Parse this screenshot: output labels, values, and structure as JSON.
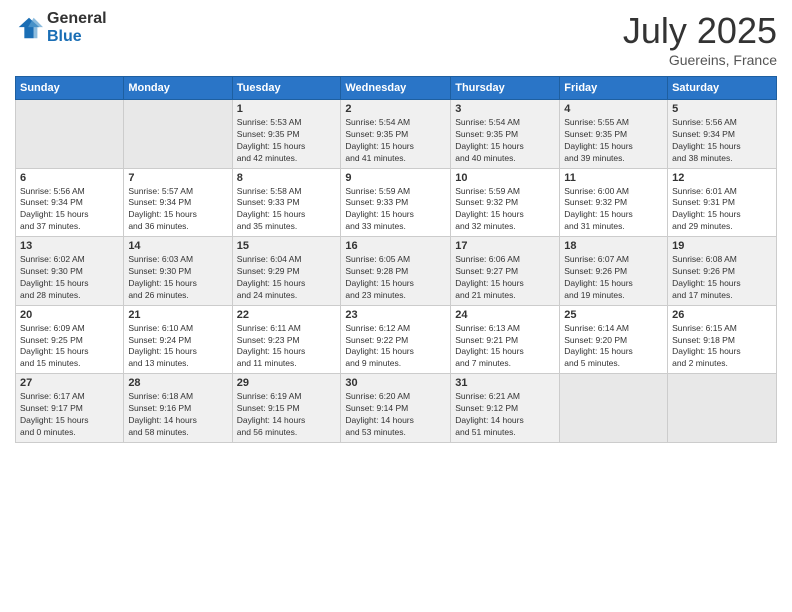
{
  "header": {
    "logo_general": "General",
    "logo_blue": "Blue",
    "month_title": "July 2025",
    "location": "Guereins, France"
  },
  "weekdays": [
    "Sunday",
    "Monday",
    "Tuesday",
    "Wednesday",
    "Thursday",
    "Friday",
    "Saturday"
  ],
  "weeks": [
    [
      {
        "day": "",
        "info": ""
      },
      {
        "day": "",
        "info": ""
      },
      {
        "day": "1",
        "info": "Sunrise: 5:53 AM\nSunset: 9:35 PM\nDaylight: 15 hours\nand 42 minutes."
      },
      {
        "day": "2",
        "info": "Sunrise: 5:54 AM\nSunset: 9:35 PM\nDaylight: 15 hours\nand 41 minutes."
      },
      {
        "day": "3",
        "info": "Sunrise: 5:54 AM\nSunset: 9:35 PM\nDaylight: 15 hours\nand 40 minutes."
      },
      {
        "day": "4",
        "info": "Sunrise: 5:55 AM\nSunset: 9:35 PM\nDaylight: 15 hours\nand 39 minutes."
      },
      {
        "day": "5",
        "info": "Sunrise: 5:56 AM\nSunset: 9:34 PM\nDaylight: 15 hours\nand 38 minutes."
      }
    ],
    [
      {
        "day": "6",
        "info": "Sunrise: 5:56 AM\nSunset: 9:34 PM\nDaylight: 15 hours\nand 37 minutes."
      },
      {
        "day": "7",
        "info": "Sunrise: 5:57 AM\nSunset: 9:34 PM\nDaylight: 15 hours\nand 36 minutes."
      },
      {
        "day": "8",
        "info": "Sunrise: 5:58 AM\nSunset: 9:33 PM\nDaylight: 15 hours\nand 35 minutes."
      },
      {
        "day": "9",
        "info": "Sunrise: 5:59 AM\nSunset: 9:33 PM\nDaylight: 15 hours\nand 33 minutes."
      },
      {
        "day": "10",
        "info": "Sunrise: 5:59 AM\nSunset: 9:32 PM\nDaylight: 15 hours\nand 32 minutes."
      },
      {
        "day": "11",
        "info": "Sunrise: 6:00 AM\nSunset: 9:32 PM\nDaylight: 15 hours\nand 31 minutes."
      },
      {
        "day": "12",
        "info": "Sunrise: 6:01 AM\nSunset: 9:31 PM\nDaylight: 15 hours\nand 29 minutes."
      }
    ],
    [
      {
        "day": "13",
        "info": "Sunrise: 6:02 AM\nSunset: 9:30 PM\nDaylight: 15 hours\nand 28 minutes."
      },
      {
        "day": "14",
        "info": "Sunrise: 6:03 AM\nSunset: 9:30 PM\nDaylight: 15 hours\nand 26 minutes."
      },
      {
        "day": "15",
        "info": "Sunrise: 6:04 AM\nSunset: 9:29 PM\nDaylight: 15 hours\nand 24 minutes."
      },
      {
        "day": "16",
        "info": "Sunrise: 6:05 AM\nSunset: 9:28 PM\nDaylight: 15 hours\nand 23 minutes."
      },
      {
        "day": "17",
        "info": "Sunrise: 6:06 AM\nSunset: 9:27 PM\nDaylight: 15 hours\nand 21 minutes."
      },
      {
        "day": "18",
        "info": "Sunrise: 6:07 AM\nSunset: 9:26 PM\nDaylight: 15 hours\nand 19 minutes."
      },
      {
        "day": "19",
        "info": "Sunrise: 6:08 AM\nSunset: 9:26 PM\nDaylight: 15 hours\nand 17 minutes."
      }
    ],
    [
      {
        "day": "20",
        "info": "Sunrise: 6:09 AM\nSunset: 9:25 PM\nDaylight: 15 hours\nand 15 minutes."
      },
      {
        "day": "21",
        "info": "Sunrise: 6:10 AM\nSunset: 9:24 PM\nDaylight: 15 hours\nand 13 minutes."
      },
      {
        "day": "22",
        "info": "Sunrise: 6:11 AM\nSunset: 9:23 PM\nDaylight: 15 hours\nand 11 minutes."
      },
      {
        "day": "23",
        "info": "Sunrise: 6:12 AM\nSunset: 9:22 PM\nDaylight: 15 hours\nand 9 minutes."
      },
      {
        "day": "24",
        "info": "Sunrise: 6:13 AM\nSunset: 9:21 PM\nDaylight: 15 hours\nand 7 minutes."
      },
      {
        "day": "25",
        "info": "Sunrise: 6:14 AM\nSunset: 9:20 PM\nDaylight: 15 hours\nand 5 minutes."
      },
      {
        "day": "26",
        "info": "Sunrise: 6:15 AM\nSunset: 9:18 PM\nDaylight: 15 hours\nand 2 minutes."
      }
    ],
    [
      {
        "day": "27",
        "info": "Sunrise: 6:17 AM\nSunset: 9:17 PM\nDaylight: 15 hours\nand 0 minutes."
      },
      {
        "day": "28",
        "info": "Sunrise: 6:18 AM\nSunset: 9:16 PM\nDaylight: 14 hours\nand 58 minutes."
      },
      {
        "day": "29",
        "info": "Sunrise: 6:19 AM\nSunset: 9:15 PM\nDaylight: 14 hours\nand 56 minutes."
      },
      {
        "day": "30",
        "info": "Sunrise: 6:20 AM\nSunset: 9:14 PM\nDaylight: 14 hours\nand 53 minutes."
      },
      {
        "day": "31",
        "info": "Sunrise: 6:21 AM\nSunset: 9:12 PM\nDaylight: 14 hours\nand 51 minutes."
      },
      {
        "day": "",
        "info": ""
      },
      {
        "day": "",
        "info": ""
      }
    ]
  ]
}
